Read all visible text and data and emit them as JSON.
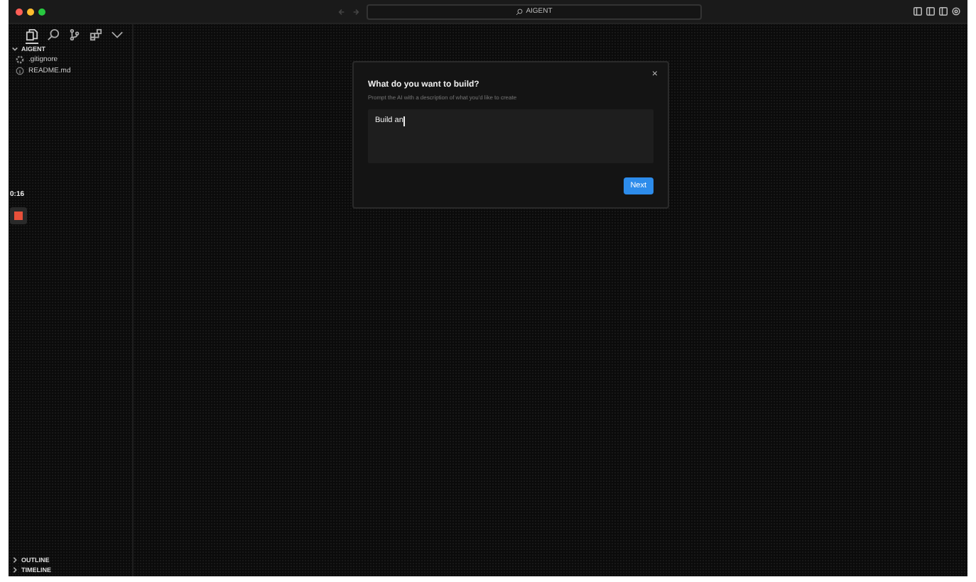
{
  "window": {
    "title": "AIGENT"
  },
  "activity_bar": [
    {
      "kind": "files",
      "selected": true
    },
    {
      "kind": "search",
      "selected": false
    },
    {
      "kind": "branch",
      "selected": false
    },
    {
      "kind": "extensions",
      "selected": false
    },
    {
      "kind": "more",
      "selected": false
    }
  ],
  "explorer": {
    "title": "AIGENT",
    "expanded": true,
    "files": [
      {
        "name": ".gitignore",
        "kind": "gear"
      },
      {
        "name": "README.md",
        "kind": "info"
      }
    ]
  },
  "recorder": {
    "time": "0:16"
  },
  "panels": [
    {
      "title": "OUTLINE",
      "expanded": false
    },
    {
      "title": "TIMELINE",
      "expanded": false
    }
  ],
  "dialog": {
    "title": "What do you want to build?",
    "subtitle": "Prompt the AI with a description of what you'd like to create",
    "close": "×",
    "value": "Build an",
    "button": "Next"
  }
}
